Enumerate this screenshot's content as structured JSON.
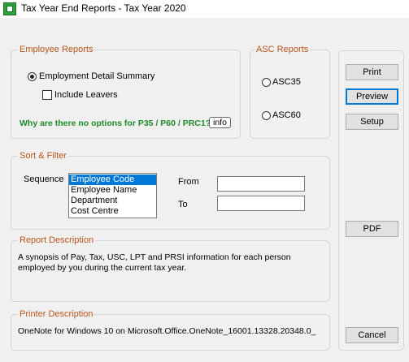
{
  "window": {
    "title": "Tax Year End Reports - Tax Year 2020"
  },
  "employee_reports": {
    "legend": "Employee Reports",
    "option_label": "Employment Detail Summary",
    "option_selected": true,
    "include_leavers_label": "Include Leavers",
    "include_leavers_checked": false,
    "question": "Why are there no options for P35 / P60 / PRC1?",
    "info_label": "info"
  },
  "asc_reports": {
    "legend": "ASC Reports",
    "options": [
      "ASC35",
      "ASC60"
    ]
  },
  "sort_filter": {
    "legend": "Sort & Filter",
    "sequence_label": "Sequence",
    "sequence_options": [
      "Employee Code",
      "Employee Name",
      "Department",
      "Cost Centre"
    ],
    "selected_index": 0,
    "from_label": "From",
    "to_label": "To",
    "from_value": "",
    "to_value": ""
  },
  "report_description": {
    "legend": "Report Description",
    "line1": "A synopsis of Pay, Tax, USC, LPT and PRSI information for each person",
    "line2": "employed by you during the current tax year."
  },
  "printer_description": {
    "legend": "Printer Description",
    "text": "OneNote for Windows 10 on Microsoft.Office.OneNote_16001.13328.20348.0_"
  },
  "buttons": {
    "print": "Print",
    "preview": "Preview",
    "setup": "Setup",
    "pdf": "PDF",
    "cancel": "Cancel"
  },
  "colors": {
    "legend_text": "#b8551c",
    "question_text": "#1f8c2a",
    "selection": "#0078d7",
    "focus_border": "#0078d7"
  }
}
